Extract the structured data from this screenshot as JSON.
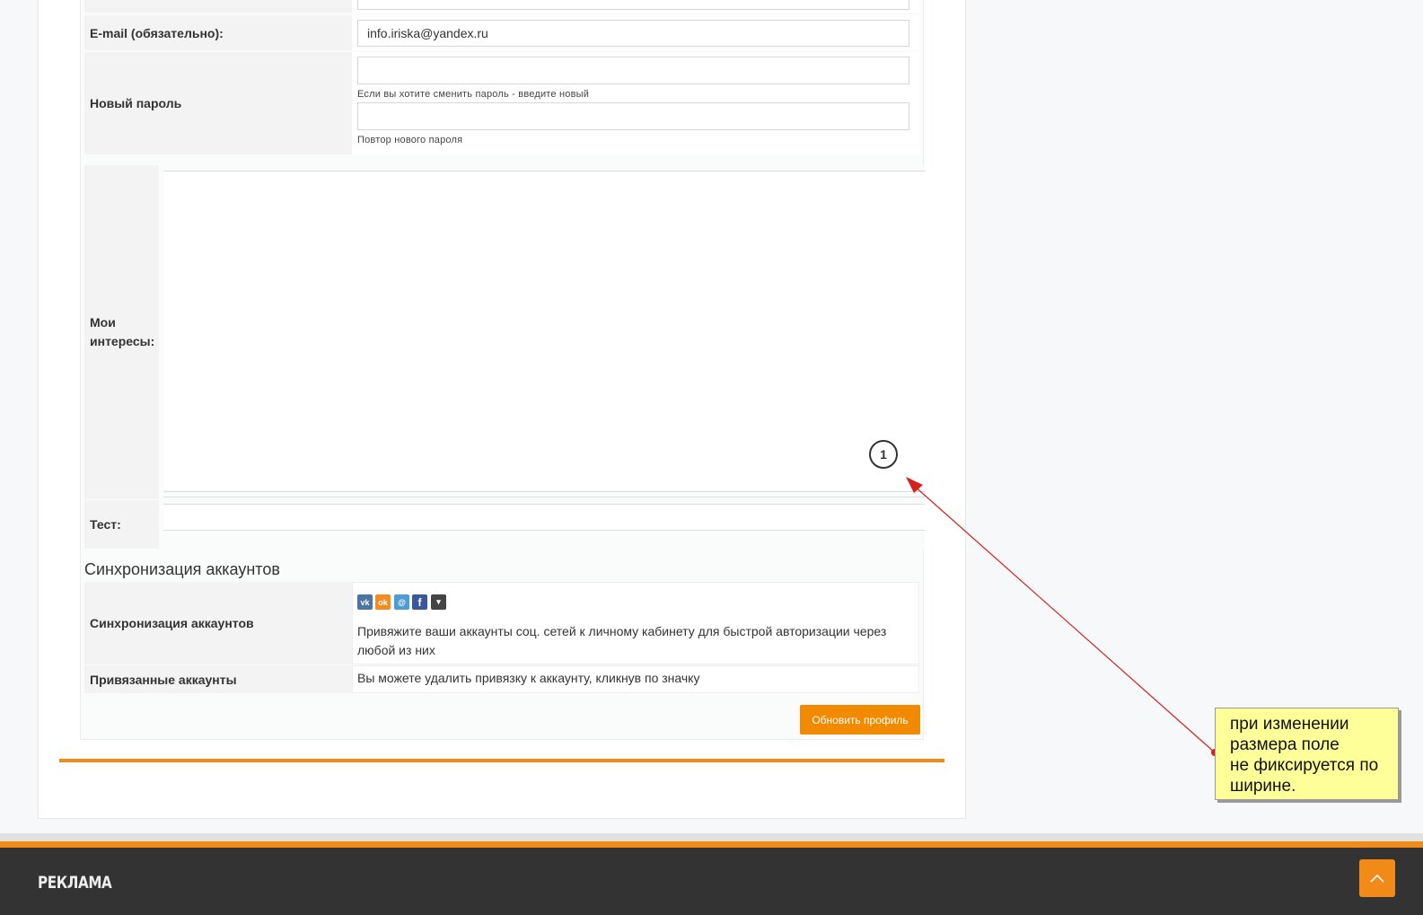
{
  "form": {
    "email_label": "E-mail (обязательно):",
    "email_value": "info.iriska@yandex.ru",
    "password_label": "Новый пароль",
    "password_hint": "Если вы хотите сменить пароль - введите новый",
    "password_repeat_hint": "Повтор нового пароля",
    "interests_label": "Мои интересы:",
    "test_label": "Тест:"
  },
  "sync": {
    "section_title": "Синхронизация аккаунтов",
    "label": "Синхронизация аккаунтов",
    "description": "Привяжите ваши аккаунты соц. сетей к личному кабинету для быстрой авторизации через любой из них",
    "linked_label": "Привязанные аккаунты",
    "linked_text": "Вы можете удалить привязку к аккаунту, кликнув по значку",
    "social_icons": [
      {
        "name": "vkontakte-icon",
        "glyph": "vk",
        "color": "#4c75a3"
      },
      {
        "name": "odnoklassniki-icon",
        "glyph": "ok",
        "color": "#f38b20"
      },
      {
        "name": "mailru-icon",
        "glyph": "@",
        "color": "#4d9cd3"
      },
      {
        "name": "facebook-icon",
        "glyph": "f",
        "color": "#3b5998"
      },
      {
        "name": "more-icon",
        "glyph": "▾",
        "color": "#444444"
      }
    ]
  },
  "update_button": "Обновить профиль",
  "annotation": {
    "marker": "1",
    "note_line1": "при изменении",
    "note_line2": "размера поле",
    "note_line3": "не фиксируется по",
    "note_line4": "ширине."
  },
  "footer": {
    "title": "РЕКЛАМА",
    "to_top_icon": "chevron-up-icon"
  }
}
